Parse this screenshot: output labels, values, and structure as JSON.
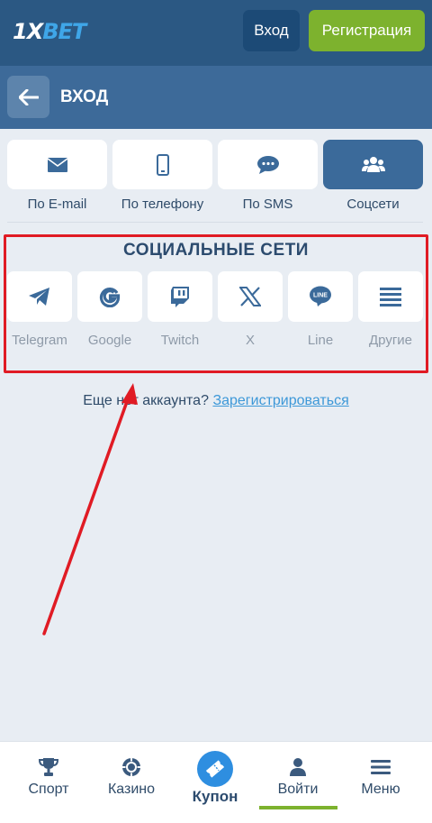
{
  "header": {
    "logo_prefix": "1X",
    "logo_suffix": "BET",
    "login_label": "Вход",
    "register_label": "Регистрация"
  },
  "subheader": {
    "title": "ВХОД"
  },
  "login_methods": [
    {
      "label": "По E-mail",
      "icon": "envelope-icon",
      "active": false
    },
    {
      "label": "По телефону",
      "icon": "phone-icon",
      "active": false
    },
    {
      "label": "По SMS",
      "icon": "sms-icon",
      "active": false
    },
    {
      "label": "Соцсети",
      "icon": "users-icon",
      "active": true
    }
  ],
  "social": {
    "title": "СОЦИАЛЬНЫЕ СЕТИ",
    "networks": [
      {
        "label": "Telegram",
        "icon": "telegram-icon"
      },
      {
        "label": "Google",
        "icon": "google-icon"
      },
      {
        "label": "Twitch",
        "icon": "twitch-icon"
      },
      {
        "label": "X",
        "icon": "x-icon"
      },
      {
        "label": "Line",
        "icon": "line-icon"
      },
      {
        "label": "Другие",
        "icon": "menu-icon"
      }
    ]
  },
  "signup_prompt": {
    "text": "Еще нет аккаунта?",
    "link": "Зарегистрироваться"
  },
  "bottom_nav": [
    {
      "label": "Спорт",
      "icon": "trophy-icon"
    },
    {
      "label": "Казино",
      "icon": "casino-chip-icon"
    },
    {
      "label": "Купон",
      "icon": "ticket-icon"
    },
    {
      "label": "Войти",
      "icon": "person-icon",
      "active": true
    },
    {
      "label": "Меню",
      "icon": "hamburger-icon"
    }
  ],
  "colors": {
    "header_bg": "#2b5883",
    "subheader_bg": "#3d6a99",
    "accent_green": "#7db22e",
    "active_tab": "#3b6a9a",
    "annotation_red": "#e01b24",
    "link_blue": "#3d98d8"
  }
}
